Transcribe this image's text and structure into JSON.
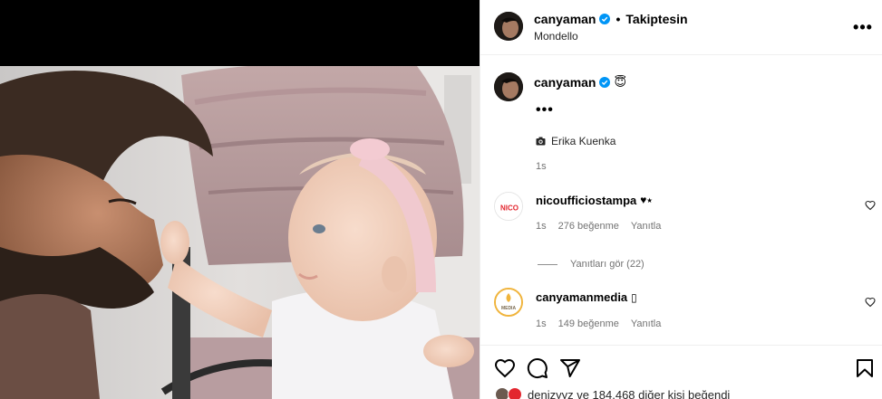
{
  "post": {
    "username": "canyaman",
    "dot": "•",
    "follow_state": "Takiptesin",
    "location": "Mondello",
    "more_label": "•••"
  },
  "caption": {
    "username": "canyaman",
    "emoji": "😇",
    "text": "•••",
    "credit": "Erika Kuenka",
    "time": "1s"
  },
  "comments": [
    {
      "username": "nicoufficiostampa",
      "text": "♥⭑",
      "avatar_text": "NICO",
      "time": "1s",
      "likes": "276 beğenme",
      "reply": "Yanıtla",
      "view_replies": "Yanıtları gör (22)"
    },
    {
      "username": "canyamanmedia",
      "text": "▯",
      "avatar_text": "MEDIA",
      "time": "1s",
      "likes": "149 beğenme",
      "reply": "Yanıtla"
    }
  ],
  "likes_summary": {
    "text": "denizyyz ve 184.468 diğer kişi beğendi"
  },
  "colors": {
    "verified": "#0095f6",
    "muted": "#737373",
    "border": "#efefef",
    "nico_red": "#e3262f",
    "media_ring": "#f0b43c"
  }
}
